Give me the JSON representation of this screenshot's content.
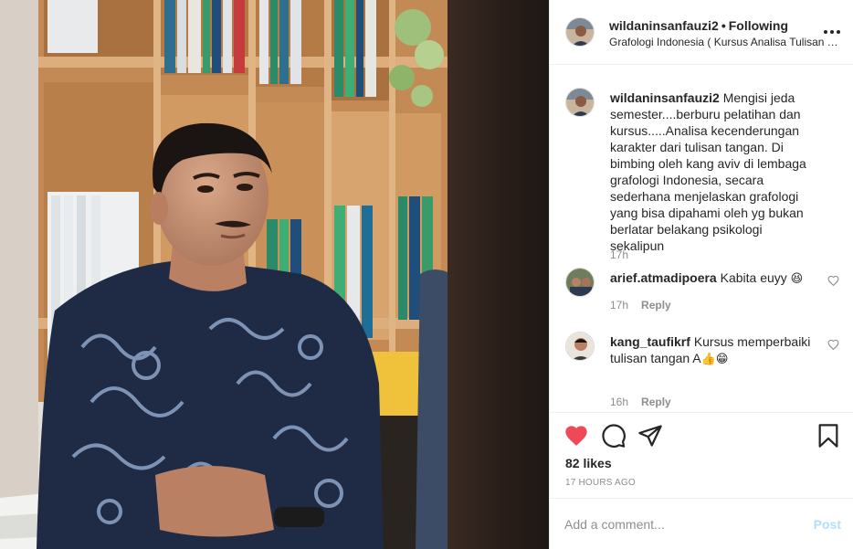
{
  "post": {
    "image_alt": "Man in batik shirt seated in front of bookshelves",
    "author": "wildaninsanfauzi2",
    "separator": "•",
    "follow_state": "Following",
    "location": "Grafologi Indonesia ( Kursus Analisa Tulisan Tangan )",
    "caption": {
      "username": "wildaninsanfauzi2",
      "text": "Mengisi jeda semester....berburu pelatihan dan kursus.....Analisa kecenderungan karakter dari tulisan tangan. Di bimbing oleh kang aviv di lembaga grafologi Indonesia, secara sederhana menjelaskan grafologi yang bisa dipahami oleh yg bukan berlatar belakang psikologi sekalipun",
      "age": "17h"
    },
    "comments": [
      {
        "username": "arief.atmadipoera",
        "text": "Kabita euyy",
        "emoji": "😆",
        "age": "17h",
        "reply": "Reply"
      },
      {
        "username": "kang_taufikrf",
        "text": "Kursus memperbaiki tulisan tangan A",
        "emoji": "👍😁",
        "age": "16h",
        "reply": "Reply"
      }
    ],
    "likes": "82 likes",
    "posted": "17 HOURS AGO",
    "add_comment_placeholder": "Add a comment...",
    "post_label": "Post"
  },
  "colors": {
    "like_red": "#ed4956",
    "post_disabled": "#b2dffc",
    "muted": "#8e8e8e"
  },
  "icons": [
    "more-icon",
    "heart-filled-icon",
    "comment-icon",
    "share-icon",
    "bookmark-icon",
    "heart-outline-icon"
  ]
}
